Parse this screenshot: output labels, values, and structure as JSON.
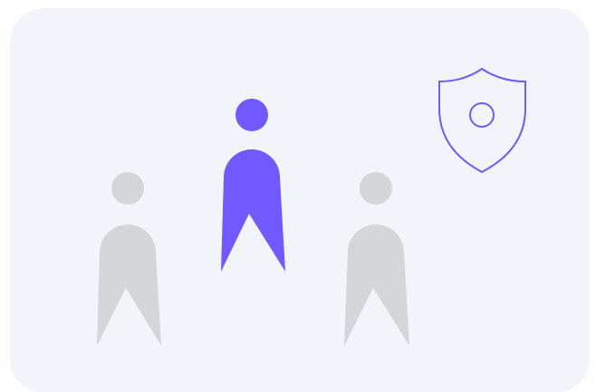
{
  "card": {
    "background": "#f1f4f9"
  },
  "people": [
    {
      "role": "member",
      "highlighted": false,
      "color": "#d4d5d8"
    },
    {
      "role": "member",
      "highlighted": true,
      "color": "#7158ff"
    },
    {
      "role": "member",
      "highlighted": false,
      "color": "#d4d5d8"
    }
  ],
  "shield": {
    "icon": "shield-icon",
    "stroke": "#7158ff"
  }
}
